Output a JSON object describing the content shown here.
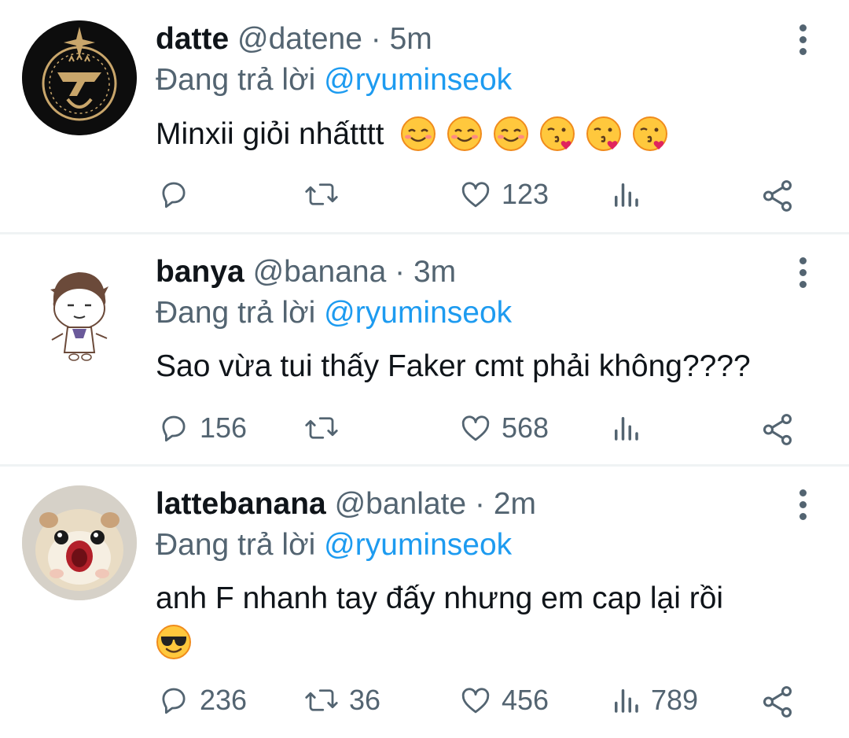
{
  "tweets": [
    {
      "name": "datte",
      "handle": "@datene",
      "sep": "·",
      "time": "5m",
      "replying_label": "Đang trả lời",
      "replying_to": "@ryuminseok",
      "text": "Minxii giỏi nhấtttt",
      "emojis": [
        "relieved-face",
        "relieved-face",
        "relieved-face",
        "face-blowing-kiss",
        "face-blowing-kiss",
        "face-blowing-kiss"
      ],
      "avatar": "avatar-team-crest",
      "replies": "",
      "retweets": "",
      "likes": "123",
      "views": ""
    },
    {
      "name": "banya",
      "handle": "@banana",
      "sep": "·",
      "time": "3m",
      "replying_label": "Đang trả lời",
      "replying_to": "@ryuminseok",
      "text": "Sao vừa tui thấy Faker cmt phải không????",
      "emojis": [],
      "avatar": "avatar-chibi-character",
      "replies": "156",
      "retweets": "",
      "likes": "568",
      "views": ""
    },
    {
      "name": "lattebanana",
      "handle": "@banlate",
      "sep": "·",
      "time": "2m",
      "replying_label": "Đang trả lời",
      "replying_to": "@ryuminseok",
      "text": "anh F nhanh tay đấy nhưng em cap lại rồi",
      "emojis": [
        "smiling-face-with-sunglasses"
      ],
      "avatar": "avatar-hamster",
      "replies": "236",
      "retweets": "36",
      "likes": "456",
      "views": "789"
    }
  ],
  "colors": {
    "muted": "#536471",
    "link": "#1d9bf0",
    "divider": "#eff3f4",
    "text": "#0f1419"
  }
}
